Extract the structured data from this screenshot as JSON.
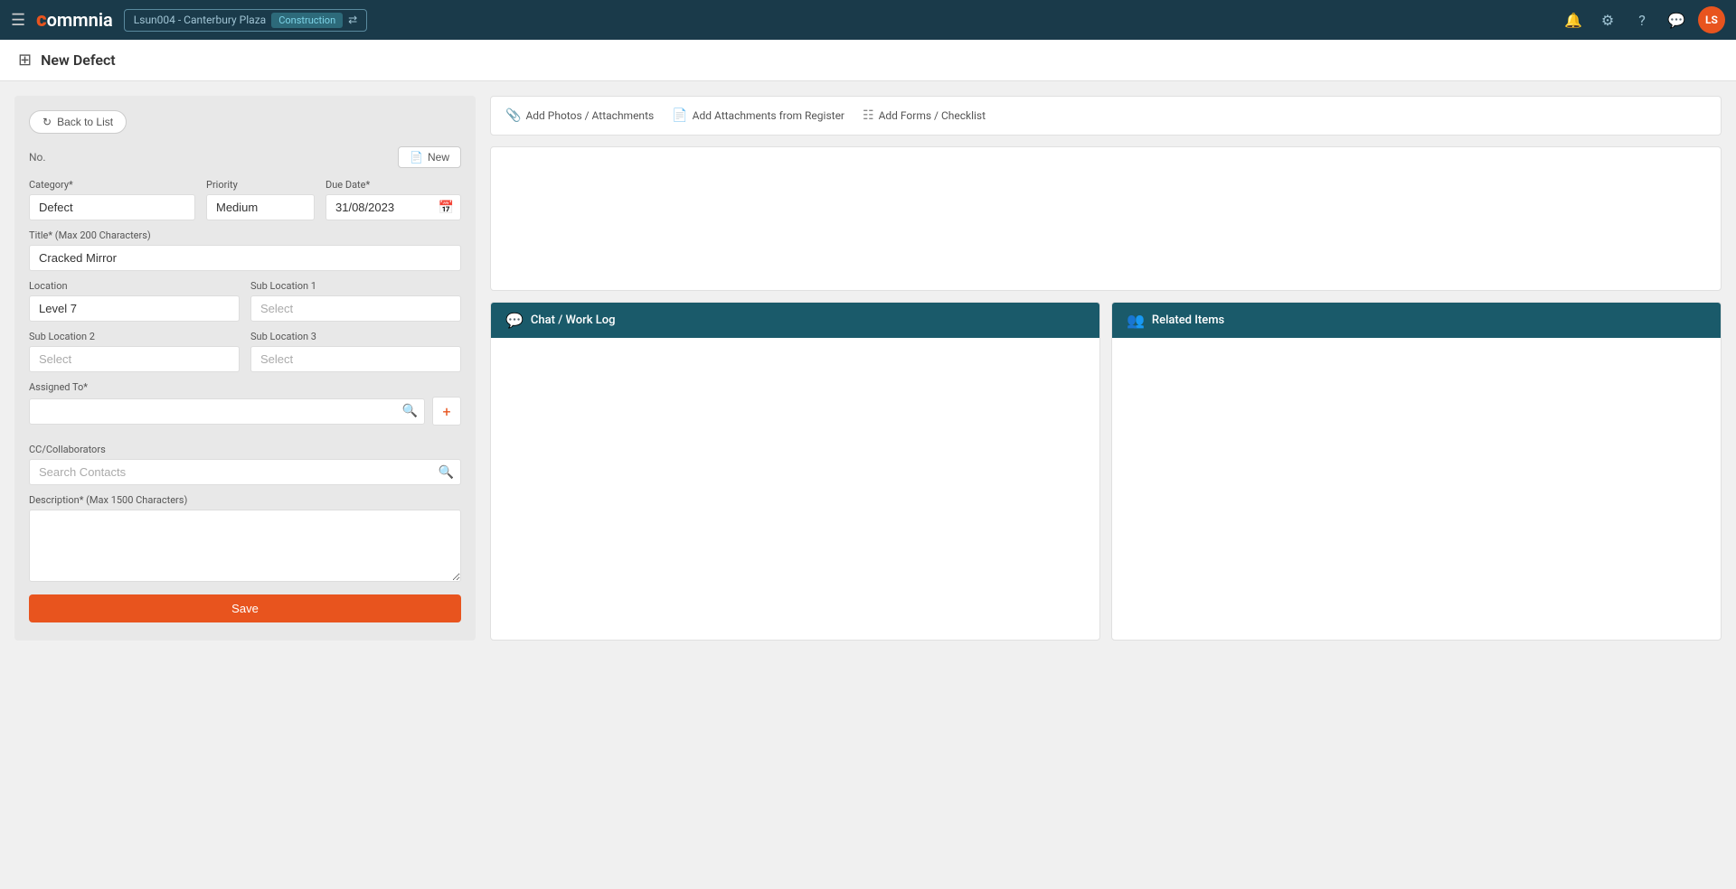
{
  "topnav": {
    "hamburger": "☰",
    "logo": "commnia",
    "project": "Lsun004 - Canterbury Plaza",
    "badge": "Construction",
    "swap_icon": "⇄",
    "nav_icons": [
      "🔔",
      "⚙",
      "?",
      "💬"
    ],
    "user_initials": "LS"
  },
  "page": {
    "title": "New Defect",
    "icon": "⊞"
  },
  "form": {
    "back_label": "Back to List",
    "no_label": "No.",
    "new_btn_label": "New",
    "category_label": "Category*",
    "category_value": "Defect",
    "priority_label": "Priority",
    "priority_value": "Medium",
    "due_date_label": "Due Date*",
    "due_date_value": "31/08/2023",
    "title_label": "Title* (Max 200 Characters)",
    "title_value": "Cracked Mirror",
    "location_label": "Location",
    "location_value": "Level 7",
    "sub_location1_label": "Sub Location 1",
    "sub_location1_placeholder": "Select",
    "sub_location2_label": "Sub Location 2",
    "sub_location2_placeholder": "Select",
    "sub_location3_label": "Sub Location 3",
    "sub_location3_placeholder": "Select",
    "assigned_label": "Assigned To*",
    "cc_label": "CC/Collaborators",
    "cc_placeholder": "Search Contacts",
    "description_label": "Description* (Max 1500 Characters)",
    "save_label": "Save"
  },
  "attachments": {
    "photos_label": "Add Photos / Attachments",
    "register_label": "Add Attachments from Register",
    "forms_label": "Add Forms / Checklist"
  },
  "chat_panel": {
    "title": "Chat / Work Log"
  },
  "related_panel": {
    "title": "Related Items"
  }
}
